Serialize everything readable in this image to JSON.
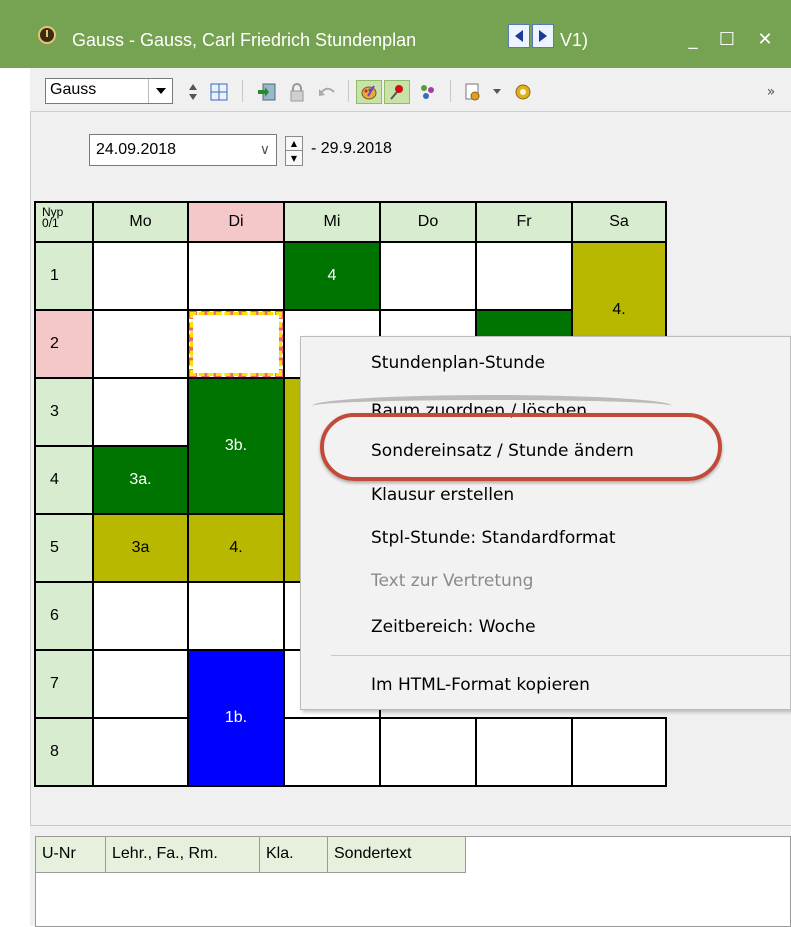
{
  "window": {
    "title": "Gauss - Gauss, Carl Friedrich  Stundenplan",
    "title_suffix": "V1)",
    "minimize": "_",
    "maximize": "☐",
    "close": "✕"
  },
  "toolbar": {
    "teacher_select": "Gauss",
    "overflow": "»"
  },
  "date": {
    "start": "24.09.2018",
    "end": "- 29.9.2018"
  },
  "grid": {
    "corner": "Nyp\n0/1",
    "days": [
      "Mo",
      "Di",
      "Mi",
      "Do",
      "Fr",
      "Sa"
    ],
    "periods": [
      "1",
      "2",
      "3",
      "4",
      "5",
      "6",
      "7",
      "8"
    ],
    "lessons": {
      "mi_1": "4",
      "sa_12": "4.",
      "di_34": "3b.",
      "mo_4": "3a.",
      "mo_5": "3a",
      "di_5": "4.",
      "di_78": "1b."
    }
  },
  "context_menu": {
    "items": [
      "Stundenplan-Stunde",
      "Raum zuordnen / löschen",
      "Sondereinsatz / Stunde ändern",
      "Klausur erstellen",
      "Stpl-Stunde: Standardformat",
      "Text zur Vertretung",
      "Zeitbereich: Woche",
      "Im HTML-Format kopieren"
    ],
    "disabled_index": 5,
    "highlighted_index": 2
  },
  "lower_table": {
    "columns": [
      "U-Nr",
      "Lehr., Fa., Rm.",
      "Kla.",
      "Sondertext"
    ]
  },
  "colors": {
    "title_bar": "#76a352",
    "lesson_green": "#007400",
    "lesson_olive": "#b8b800",
    "lesson_blue": "#0000ff",
    "header_green": "#d8ecd0",
    "header_pink": "#f4c8c8",
    "highlight_ring": "#c24a38"
  },
  "icons": [
    "clock-icon",
    "arrow-left-icon",
    "arrow-right-icon",
    "grid-icon",
    "import-icon",
    "lock-icon",
    "undo-icon",
    "paint-icon",
    "pin-icon",
    "people-icon",
    "document-icon",
    "gear-icon"
  ]
}
